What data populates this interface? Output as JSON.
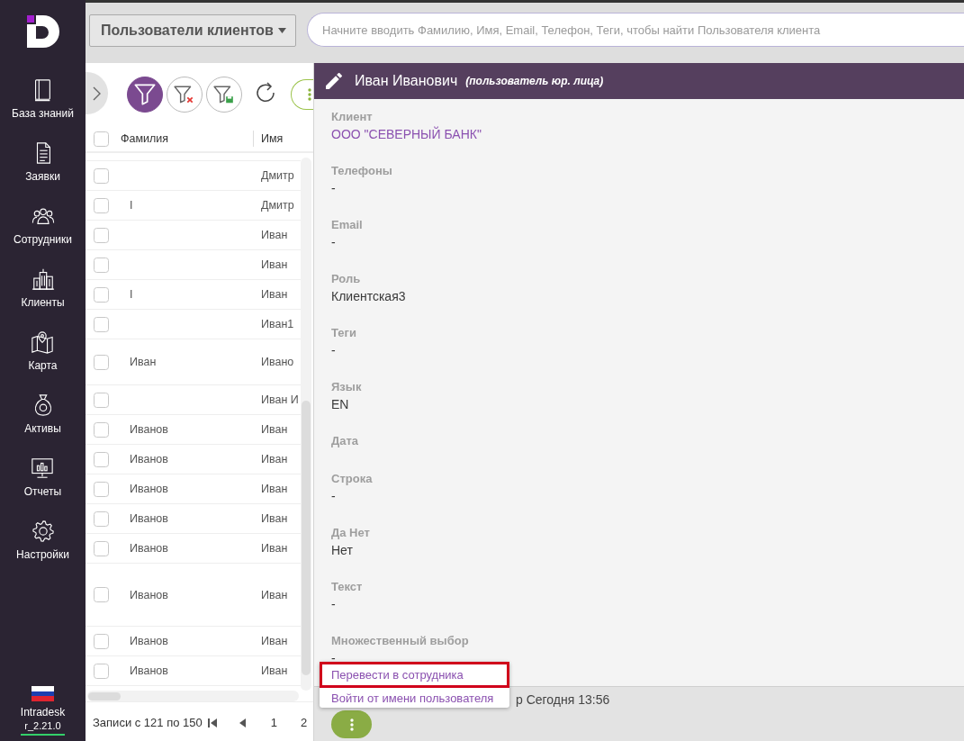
{
  "sidebar": {
    "items": [
      {
        "label": "База знаний"
      },
      {
        "label": "Заявки"
      },
      {
        "label": "Сотрудники"
      },
      {
        "label": "Клиенты"
      },
      {
        "label": "Карта"
      },
      {
        "label": "Активы"
      },
      {
        "label": "Отчеты"
      },
      {
        "label": "Настройки"
      }
    ],
    "company": "Intradesk",
    "version": "r_2.21.0"
  },
  "top_bar": {
    "section_dropdown": "Пользователи клиентов",
    "search": {
      "placeholder": "Начните вводить Фамилию, Имя, Email, Телефон, Теги, чтобы найти Пользователя клиента"
    }
  },
  "toolbar": {
    "filters": [
      {
        "kind": "filter",
        "selected": true
      },
      {
        "kind": "clear",
        "selected": false
      },
      {
        "kind": "save",
        "selected": false
      }
    ]
  },
  "table": {
    "header_checked": false,
    "columns": [
      "Фамилия",
      "Имя"
    ],
    "rows": [
      {
        "checked": false,
        "name": "Дмитр"
      },
      {
        "checked": false,
        "surname": "I",
        "name": "Дмитр"
      },
      {
        "checked": false,
        "name": "Иван"
      },
      {
        "checked": false,
        "name": "Иван"
      },
      {
        "checked": false,
        "surname": "I",
        "name": "Иван"
      },
      {
        "checked": false,
        "name": "Иван1"
      },
      {
        "checked": false,
        "surname": "Иван",
        "name": "Ивано"
      },
      {
        "checked": false,
        "name": "Иван И"
      },
      {
        "checked": false,
        "surname": "Иванов",
        "name": "Иван"
      },
      {
        "checked": false,
        "surname": "Иванов",
        "name": "Иван"
      },
      {
        "checked": false,
        "surname": "Иванов",
        "name": "Иван"
      },
      {
        "checked": false,
        "surname": "Иванов",
        "name": "Иван"
      },
      {
        "checked": false,
        "surname": "Иванов",
        "name": "Иван"
      },
      {
        "checked": false,
        "surname": "Иванов",
        "name": "Иван"
      },
      {
        "checked": false,
        "surname": "Иванов",
        "name": "Иван"
      },
      {
        "checked": false,
        "surname": "Иванов",
        "name": "Иван"
      }
    ]
  },
  "pagination": {
    "range": "Записи с 121 по 150",
    "pages": [
      "1",
      "2"
    ]
  },
  "detail": {
    "title": "Иван Иванович",
    "subtitle": "(пользователь юр. лица)",
    "fields": [
      {
        "label": "Клиент",
        "value": "ООО \"СЕВЕРНЫЙ БАНК\"",
        "kind": "link"
      },
      {
        "label": "Телефоны",
        "value": "-",
        "kind": "text"
      },
      {
        "label": "Email",
        "value": "-",
        "kind": "text"
      },
      {
        "label": "Роль",
        "value": "Клиентская3",
        "kind": "text"
      },
      {
        "label": "Теги",
        "value": "-",
        "kind": "text"
      },
      {
        "label": "Язык",
        "value": "EN",
        "kind": "text"
      },
      {
        "label": "Дата"
      },
      {
        "label": "Строка",
        "value": "-",
        "kind": "text"
      },
      {
        "label": "Да Нет",
        "value": "Нет",
        "kind": "text"
      },
      {
        "label": "Текст",
        "value": "-",
        "kind": "text"
      },
      {
        "label": "Множественный выбор",
        "value": "-",
        "kind": "text"
      }
    ]
  },
  "status_line": "р Сегодня 13:56",
  "context_menu": {
    "items": [
      {
        "label": "Перевести в сотрудника",
        "highlighted": true
      },
      {
        "label": "Войти от имени пользователя",
        "highlighted": false
      }
    ]
  }
}
